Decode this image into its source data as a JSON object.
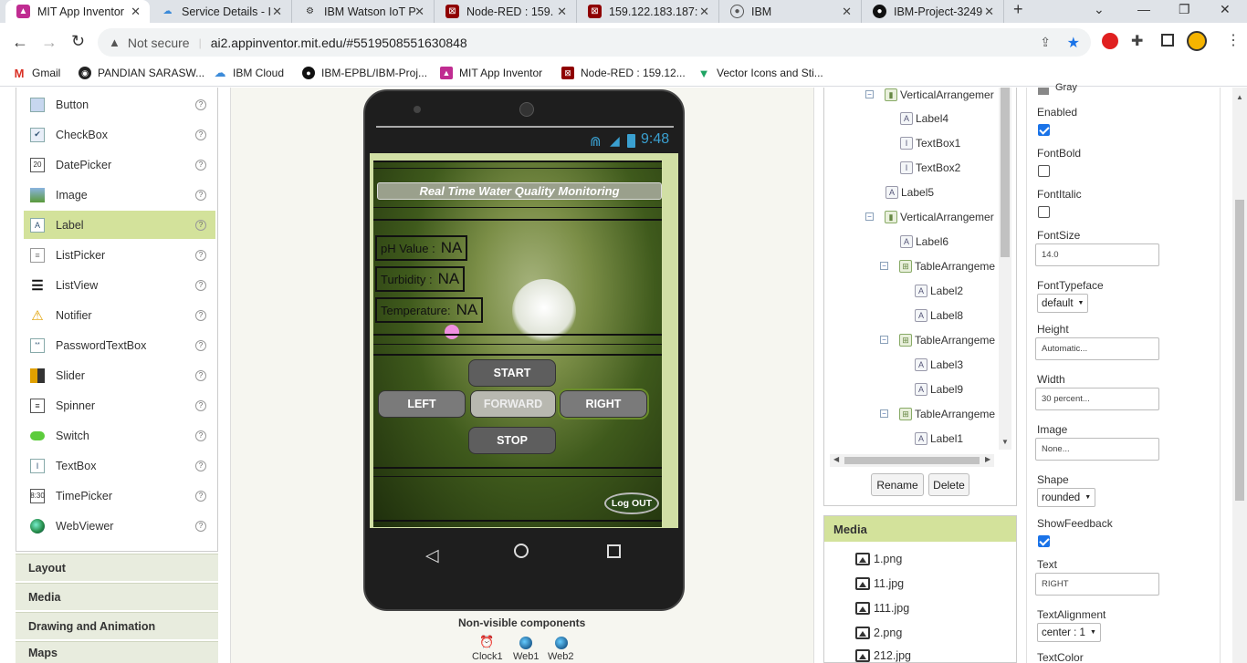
{
  "browser": {
    "tabs": [
      {
        "title": "MIT App Inventor",
        "color": "#c02c91"
      },
      {
        "title": "Service Details - I",
        "color": "#3c8bd9"
      },
      {
        "title": "IBM Watson IoT P",
        "color": "#333333"
      },
      {
        "title": "Node-RED : 159.",
        "color": "#8f0000"
      },
      {
        "title": "159.122.183.187:",
        "color": "#8f0000"
      },
      {
        "title": "IBM",
        "color": "#555555"
      },
      {
        "title": "IBM-Project-3249",
        "color": "#111111"
      }
    ],
    "new_tab": "+",
    "address": {
      "security": "Not secure",
      "url": "ai2.appinventor.mit.edu/#5519508551630848"
    },
    "bookmarks": [
      {
        "label": "Gmail",
        "color": "#d93025"
      },
      {
        "label": "PANDIAN SARASW...",
        "color": "#222222"
      },
      {
        "label": "IBM Cloud",
        "color": "#3c8bd9"
      },
      {
        "label": "IBM-EPBL/IBM-Proj...",
        "color": "#111111"
      },
      {
        "label": "MIT App Inventor",
        "color": "#c02c91"
      },
      {
        "label": "Node-RED : 159.12...",
        "color": "#8f0000"
      },
      {
        "label": "Vector Icons and Sti...",
        "color": "#1fa463"
      }
    ]
  },
  "palette": {
    "items": [
      {
        "label": "Button",
        "icon": "button-icon",
        "help": "?"
      },
      {
        "label": "CheckBox",
        "icon": "checkbox-icon",
        "help": "?"
      },
      {
        "label": "DatePicker",
        "icon": "datepicker-icon",
        "help": "?"
      },
      {
        "label": "Image",
        "icon": "image-icon",
        "help": "?"
      },
      {
        "label": "Label",
        "icon": "label-icon",
        "help": "?"
      },
      {
        "label": "ListPicker",
        "icon": "listpicker-icon",
        "help": "?"
      },
      {
        "label": "ListView",
        "icon": "listview-icon",
        "help": "?"
      },
      {
        "label": "Notifier",
        "icon": "notifier-icon",
        "help": "?"
      },
      {
        "label": "PasswordTextBox",
        "icon": "passwordtextbox-icon",
        "help": "?"
      },
      {
        "label": "Slider",
        "icon": "slider-icon",
        "help": "?"
      },
      {
        "label": "Spinner",
        "icon": "spinner-icon",
        "help": "?"
      },
      {
        "label": "Switch",
        "icon": "switch-icon",
        "help": "?"
      },
      {
        "label": "TextBox",
        "icon": "textbox-icon",
        "help": "?"
      },
      {
        "label": "TimePicker",
        "icon": "timepicker-icon",
        "help": "?"
      },
      {
        "label": "WebViewer",
        "icon": "webviewer-icon",
        "help": "?"
      }
    ],
    "selected": "Label",
    "categories": [
      "Layout",
      "Media",
      "Drawing and Animation",
      "Maps"
    ]
  },
  "phone": {
    "status_time": "9:48",
    "title": "Real Time Water Quality Monitoring",
    "ph_label": "pH Value :",
    "ph_value": "NA",
    "turbidity_label": "Turbidity :",
    "turbidity_value": "NA",
    "temperature_label": "Temperature:",
    "temperature_value": "NA",
    "buttons": {
      "start": "START",
      "left": "LEFT",
      "forward": "FORWARD",
      "right": "RIGHT",
      "stop": "STOP",
      "logout": "Log OUT"
    }
  },
  "nonvisible": {
    "title": "Non-visible components",
    "items": [
      "Clock1",
      "Web1",
      "Web2"
    ]
  },
  "tree": {
    "nodes": [
      {
        "label": "VerticalArrangemer",
        "type": "va",
        "toggle": "⊟"
      },
      {
        "label": "Label4",
        "type": "label"
      },
      {
        "label": "TextBox1",
        "type": "textbox"
      },
      {
        "label": "TextBox2",
        "type": "textbox"
      },
      {
        "label": "Label5",
        "type": "label"
      },
      {
        "label": "VerticalArrangemer",
        "type": "va",
        "toggle": "⊟"
      },
      {
        "label": "Label6",
        "type": "label"
      },
      {
        "label": "TableArrangeme",
        "type": "ta",
        "toggle": "⊟"
      },
      {
        "label": "Label2",
        "type": "label"
      },
      {
        "label": "Label8",
        "type": "label"
      },
      {
        "label": "TableArrangeme",
        "type": "ta",
        "toggle": "⊟"
      },
      {
        "label": "Label3",
        "type": "label"
      },
      {
        "label": "Label9",
        "type": "label"
      },
      {
        "label": "TableArrangeme",
        "type": "ta",
        "toggle": "⊟"
      },
      {
        "label": "Label1",
        "type": "label"
      }
    ],
    "rename": "Rename",
    "delete": "Delete"
  },
  "media": {
    "title": "Media",
    "files": [
      "1.png",
      "11.jpg",
      "111.jpg",
      "2.png",
      "212.jpg"
    ]
  },
  "properties": {
    "gray_text": "Gray",
    "enabled_label": "Enabled",
    "enabled": true,
    "fontbold_label": "FontBold",
    "fontbold": false,
    "fontitalic_label": "FontItalic",
    "fontitalic": false,
    "fontsize_label": "FontSize",
    "fontsize": "14.0",
    "fonttypeface_label": "FontTypeface",
    "fonttypeface": "default",
    "height_label": "Height",
    "height": "Automatic...",
    "width_label": "Width",
    "width": "30 percent...",
    "image_label": "Image",
    "image": "None...",
    "shape_label": "Shape",
    "shape": "rounded",
    "showfeedback_label": "ShowFeedback",
    "showfeedback": true,
    "text_label": "Text",
    "text": "RIGHT",
    "textalignment_label": "TextAlignment",
    "textalignment": "center : 1",
    "textcolor_label": "TextColor"
  }
}
